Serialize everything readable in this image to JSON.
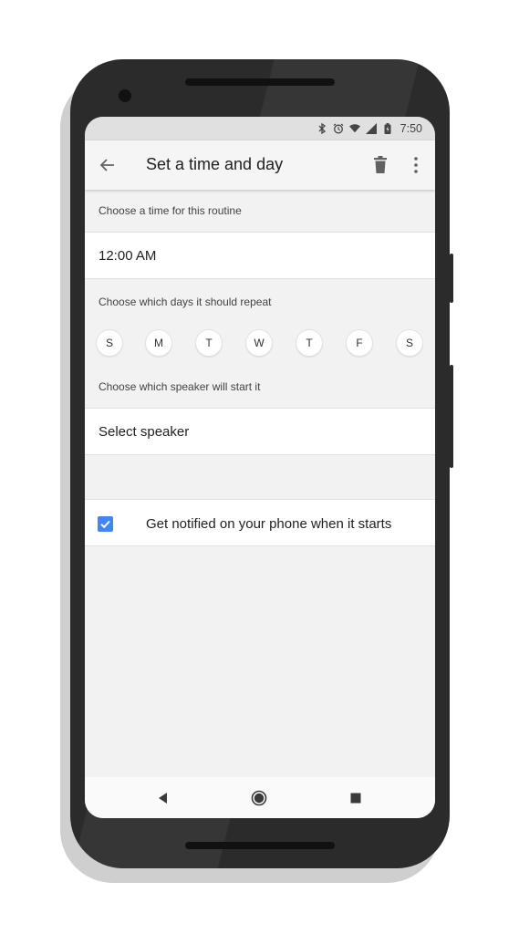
{
  "status_bar": {
    "icons": [
      "bluetooth-icon",
      "alarm-icon",
      "wifi-icon",
      "signal-icon",
      "battery-icon"
    ],
    "time": "7:50"
  },
  "app_bar": {
    "title": "Set a time and day",
    "back_icon": "arrow-left-icon",
    "delete_icon": "trash-icon",
    "more_icon": "more-vert-icon"
  },
  "time_section": {
    "label": "Choose a time for this routine",
    "value": "12:00 AM"
  },
  "days_section": {
    "label": "Choose which days it should repeat",
    "days": [
      "S",
      "M",
      "T",
      "W",
      "T",
      "F",
      "S"
    ]
  },
  "speaker_section": {
    "label": "Choose which speaker will start it",
    "value": "Select speaker"
  },
  "notify": {
    "label": "Get notified on your phone when it starts",
    "checked": true
  },
  "nav_bar": {
    "icons": [
      "back-triangle-icon",
      "home-circle-icon",
      "recents-square-icon"
    ]
  },
  "colors": {
    "accent": "#4285f4",
    "background": "#f2f2f2",
    "frame": "#2b2b2b"
  }
}
